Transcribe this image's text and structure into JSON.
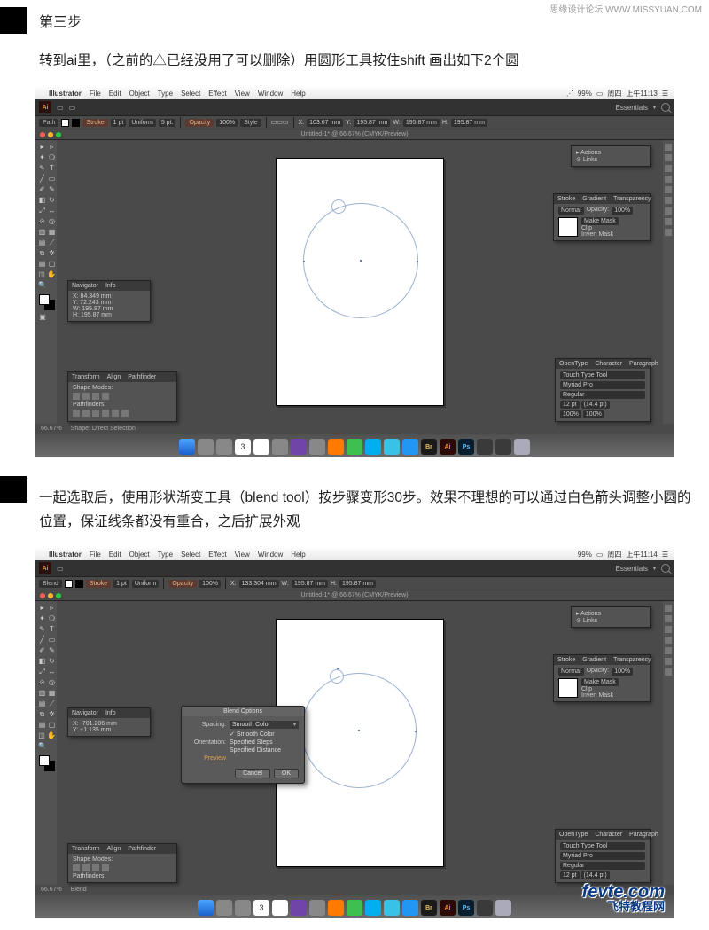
{
  "watermark_top": "思缘设计论坛  WWW.MISSYUAN.COM",
  "step_title": "第三步",
  "desc1": "转到ai里，（之前的△已经没用了可以删除）用圆形工具按住shift 画出如下2个圆",
  "desc2": "一起选取后，使用形状渐变工具（blend tool）按步骤变形30步。效果不理想的可以通过白色箭头调整小圆的位置，保证线条都没有重合，之后扩展外观",
  "mac": {
    "app": "Illustrator",
    "menus": [
      "File",
      "Edit",
      "Object",
      "Type",
      "Select",
      "Effect",
      "View",
      "Window",
      "Help"
    ],
    "battery": "99%",
    "day": "周四",
    "time1": "上午11:13",
    "time2": "上午11:14"
  },
  "workspace_label": "Essentials",
  "control": {
    "segL": "Path",
    "stroke": "Stroke",
    "uniform": "Uniform",
    "fivept": "5 pt.",
    "opacity": "Opacity",
    "opv": "100%",
    "style": "Style",
    "x1": "103.67 mm",
    "y1": "195.87 mm",
    "w1": "195.87 mm",
    "h1": "195.87 mm",
    "x2": "133.304 mm",
    "h2": "195.87 mm"
  },
  "controlB": {
    "segL": "Blend"
  },
  "doc_title": "Untitled-1* @ 66.67% (CMYK/Preview)",
  "nav": {
    "tab": "Navigator",
    "info_tab": "Info",
    "x1": "X: 84.349 mm",
    "y1": "Y: 72.243 mm",
    "w1": "W: 195.87 mm",
    "h1": "H: 195.87 mm",
    "x2": "X: -701.206 mm",
    "y2": "Y: +1.135 mm"
  },
  "path": {
    "t1": "Transform",
    "t2": "Align",
    "t3": "Pathfinder",
    "sm": "Shape Modes:",
    "pf": "Pathfinders:"
  },
  "actions": {
    "t1": "Actions",
    "t2": "Links"
  },
  "transp": {
    "tabs": [
      "Stroke",
      "Gradient",
      "Transparency"
    ],
    "mode": "Normal",
    "oplab": "Opacity:",
    "opv": "100%",
    "mm": "Make Mask",
    "clip": "Clip",
    "im": "Invert Mask"
  },
  "char": {
    "tabs": [
      "OpenType",
      "Character",
      "Paragraph"
    ],
    "tool": "Touch Type Tool",
    "font": "Myriad Pro",
    "style": "Regular",
    "size": "12 pt",
    "lead": "(14.4 pt)",
    "track": "100%",
    "kern": "100%"
  },
  "status": {
    "zoom": "66.67%",
    "sel1": "Shape: Direct Selection",
    "sel2": "Blend"
  },
  "dialog": {
    "title": "Blend Options",
    "spacing_l": "Spacing:",
    "spacing_v": "Smooth Color",
    "opt1": "Smooth Color",
    "opt2": "Specified Steps",
    "opt3": "Specified Distance",
    "orient_l": "Orientation:",
    "preview": "Preview",
    "cancel": "Cancel",
    "ok": "OK"
  },
  "bottom_wm": {
    "en": "fevte.com",
    "cn": "飞特教程网"
  }
}
